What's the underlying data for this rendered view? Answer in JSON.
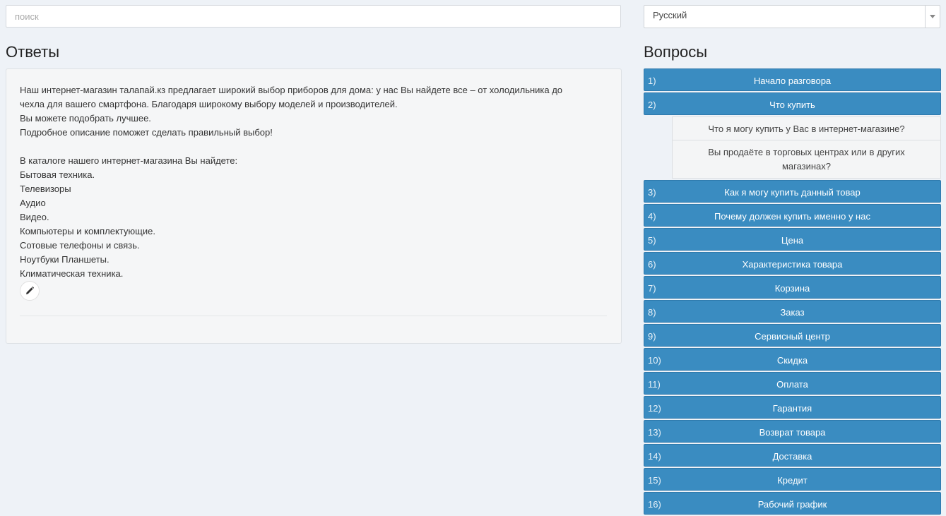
{
  "search": {
    "placeholder": "поиск"
  },
  "language": {
    "selected": "Русский"
  },
  "answers": {
    "title": "Ответы",
    "lines": [
      "Наш интернет-магазин талапай.кз предлагает широкий выбор приборов для дома: у нас Вы найдете все – от холодильника до",
      "чехла для вашего смартфона. Благодаря широкому выбору моделей и производителей.",
      "Вы можете подобрать лучшее.",
      "Подробное описание поможет сделать правильный выбор!",
      "",
      "В каталоге нашего интернет-магазина Вы найдете:",
      "Бытовая техника.",
      "Телевизоры",
      "Аудио",
      "Видео.",
      "Компьютеры и комплектующие.",
      "Сотовые телефоны и связь.",
      "Ноутбуки Планшеты.",
      "Климатическая техника."
    ],
    "edit_icon": "pencil-icon"
  },
  "questions": {
    "title": "Вопросы",
    "items": [
      {
        "num": "1)",
        "label": "Начало разговора"
      },
      {
        "num": "2)",
        "label": "Что купить",
        "sub": [
          "Что я могу купить у Вас в интернет-магазине?",
          "Вы продаёте в торговых центрах или в других магазинах?"
        ]
      },
      {
        "num": "3)",
        "label": "Как я могу купить данный товар"
      },
      {
        "num": "4)",
        "label": "Почему должен купить именно у нас"
      },
      {
        "num": "5)",
        "label": "Цена"
      },
      {
        "num": "6)",
        "label": "Характеристика товара"
      },
      {
        "num": "7)",
        "label": "Корзина"
      },
      {
        "num": "8)",
        "label": "Заказ"
      },
      {
        "num": "9)",
        "label": "Сервисный центр"
      },
      {
        "num": "10)",
        "label": "Скидка"
      },
      {
        "num": "11)",
        "label": "Оплата"
      },
      {
        "num": "12)",
        "label": "Гарантия"
      },
      {
        "num": "13)",
        "label": "Возврат товара"
      },
      {
        "num": "14)",
        "label": "Доставка"
      },
      {
        "num": "15)",
        "label": "Кредит"
      },
      {
        "num": "16)",
        "label": "Рабочий график"
      }
    ]
  },
  "colors": {
    "accent": "#3a8cc1",
    "background": "#eef2f7"
  }
}
